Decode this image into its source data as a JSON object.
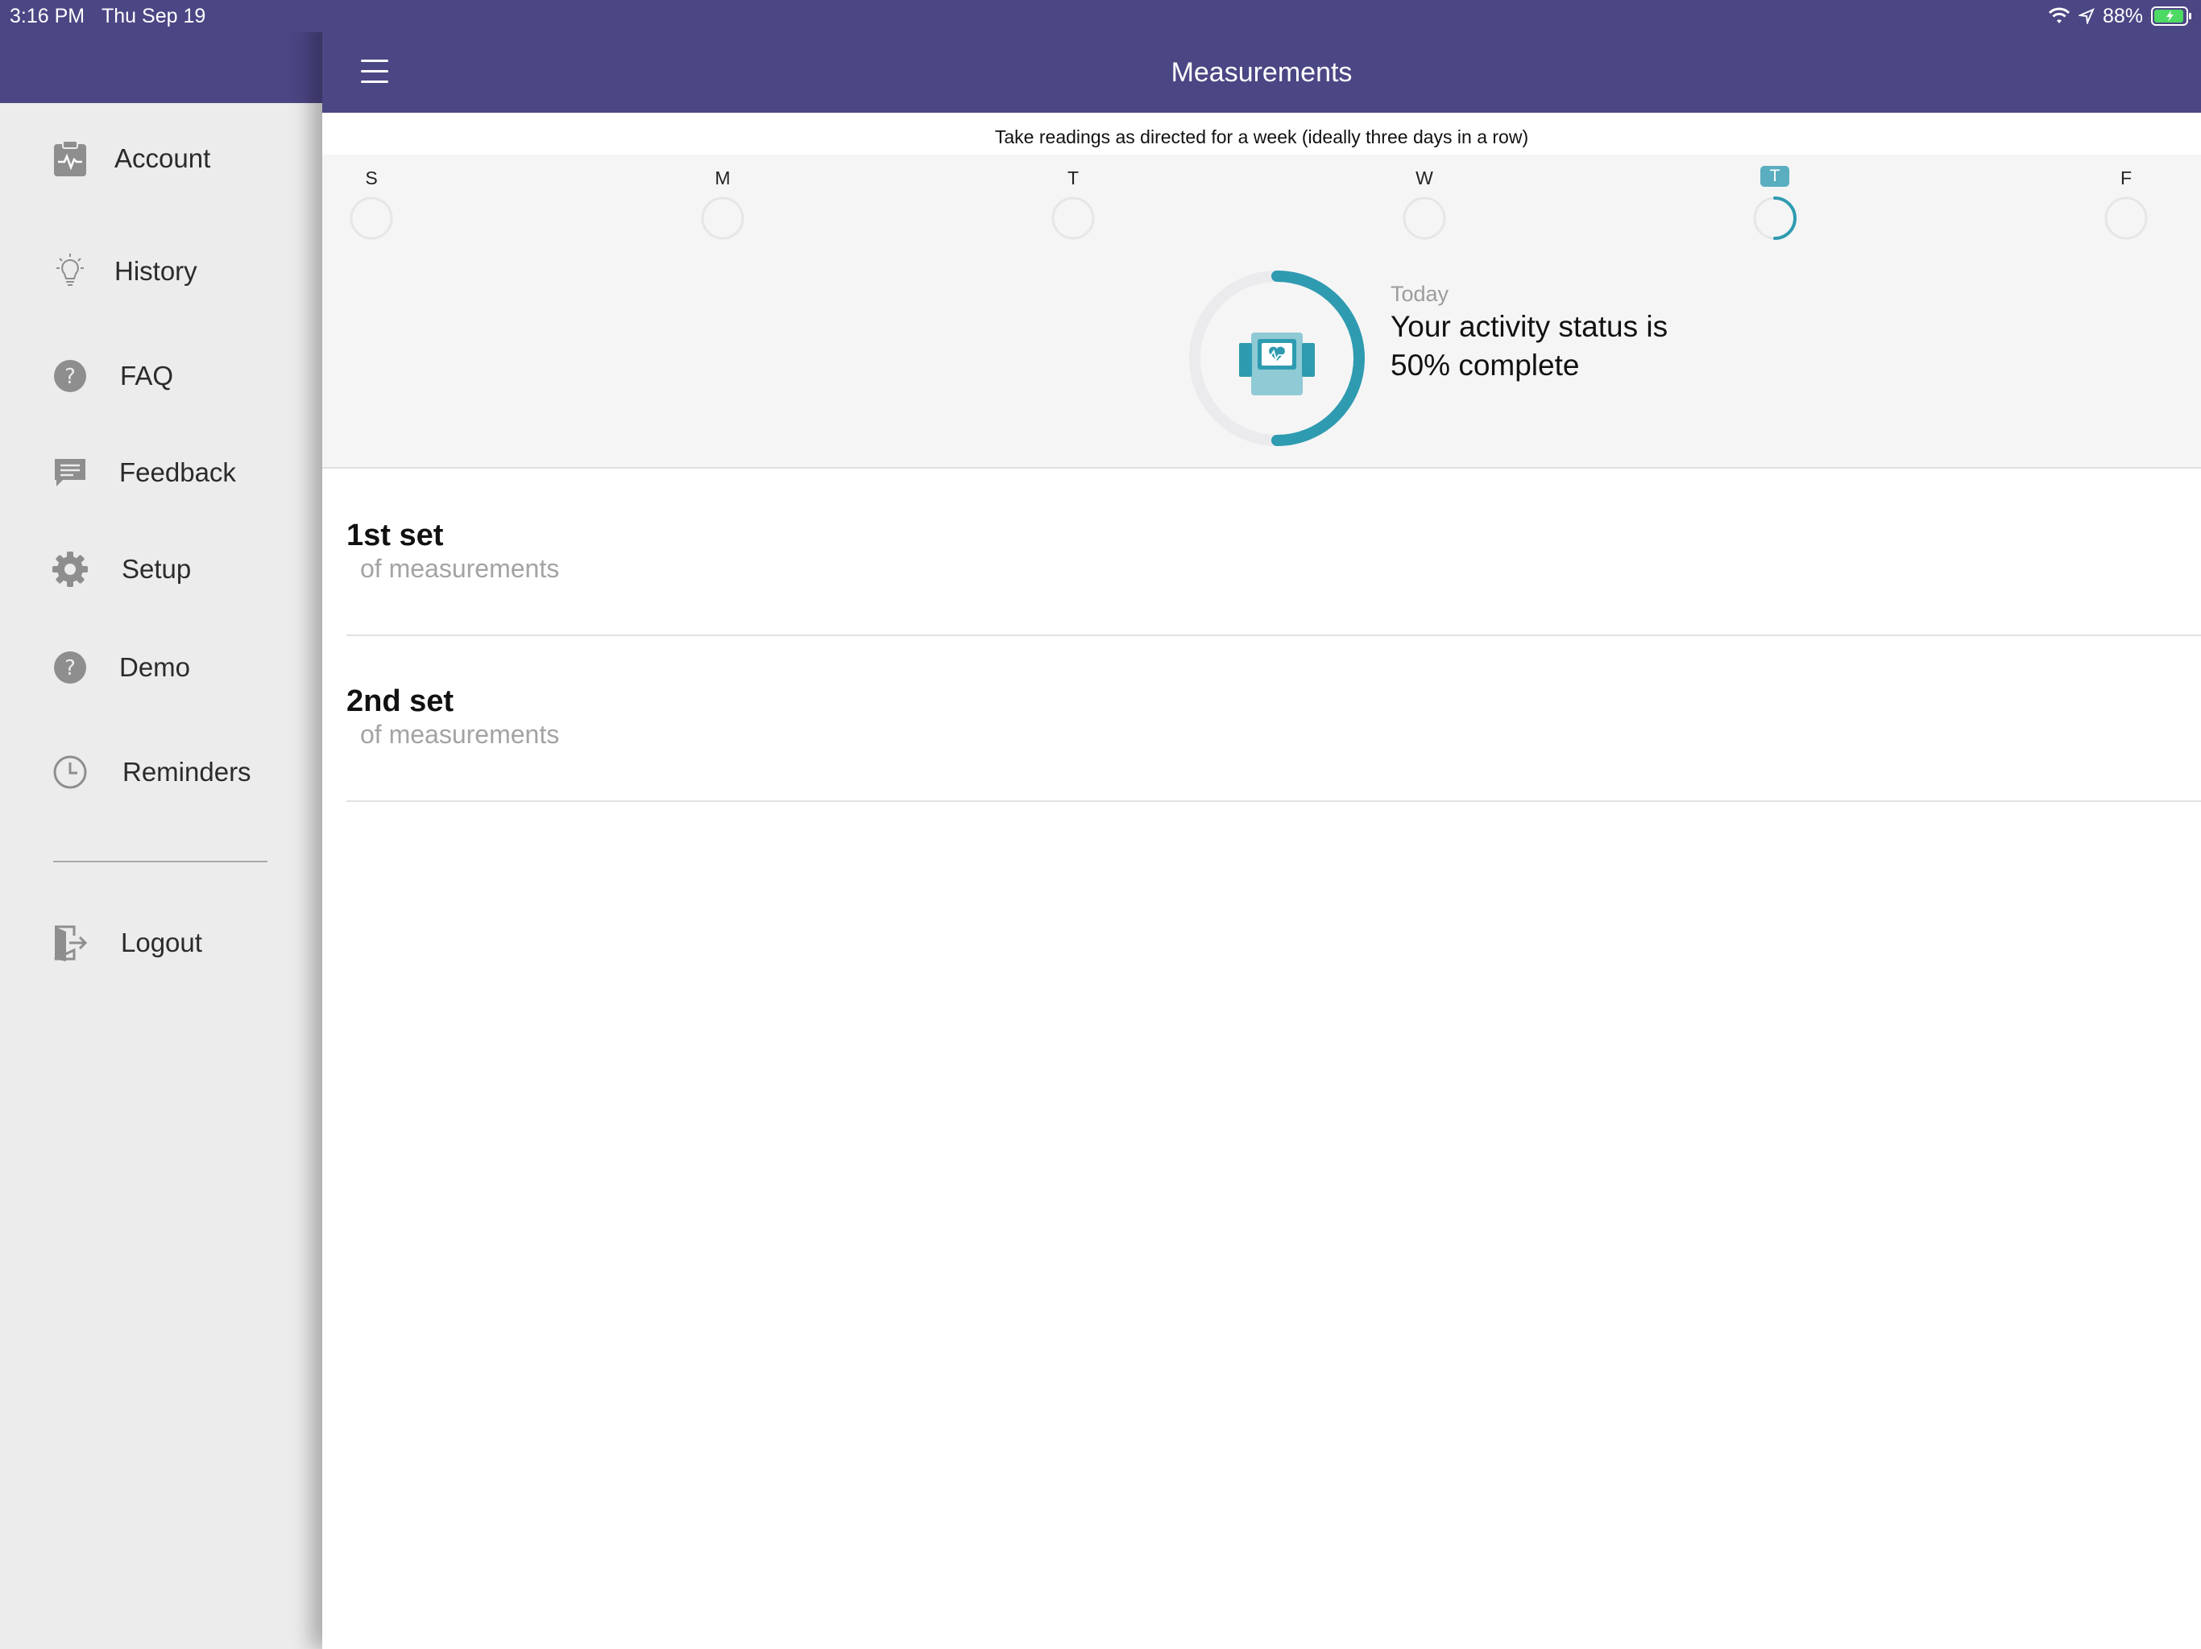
{
  "status_bar": {
    "time": "3:16 PM",
    "date": "Thu Sep 19",
    "battery": "88%",
    "icons": [
      "wifi-icon",
      "location-arrow-icon",
      "battery-charging-icon"
    ]
  },
  "drawer": {
    "items": [
      {
        "label": "Account",
        "icon": "clipboard-pulse-icon"
      },
      {
        "label": "History",
        "icon": "lightbulb-icon"
      },
      {
        "label": "FAQ",
        "icon": "question-circle-icon"
      },
      {
        "label": "Feedback",
        "icon": "chat-bubble-icon"
      },
      {
        "label": "Setup",
        "icon": "gear-icon"
      },
      {
        "label": "Demo",
        "icon": "question-circle-icon"
      },
      {
        "label": "Reminders",
        "icon": "clock-icon"
      }
    ],
    "logout": {
      "label": "Logout",
      "icon": "logout-door-icon"
    }
  },
  "navbar": {
    "title": "Measurements",
    "menu_icon": "hamburger-icon"
  },
  "instruction": "Take readings as directed for a week (ideally three days in a row)",
  "week": {
    "days": [
      {
        "label": "S",
        "progress": 0,
        "today": false
      },
      {
        "label": "M",
        "progress": 0,
        "today": false
      },
      {
        "label": "T",
        "progress": 0,
        "today": false
      },
      {
        "label": "W",
        "progress": 0,
        "today": false
      },
      {
        "label": "T",
        "progress": 0.5,
        "today": true
      },
      {
        "label": "F",
        "progress": 0,
        "today": false
      }
    ]
  },
  "activity": {
    "label": "Today",
    "status": "Your activity status is 50% complete",
    "progress": 0.5,
    "icon": "heart-monitor-device-icon"
  },
  "sets": [
    {
      "title": "1st set",
      "subtitle": "of measurements"
    },
    {
      "title": "2nd set",
      "subtitle": "of measurements"
    }
  ],
  "colors": {
    "primary": "#4b4684",
    "accent": "#2e9bb0",
    "today_badge": "#5aaebf",
    "drawer_bg": "#ececec"
  }
}
